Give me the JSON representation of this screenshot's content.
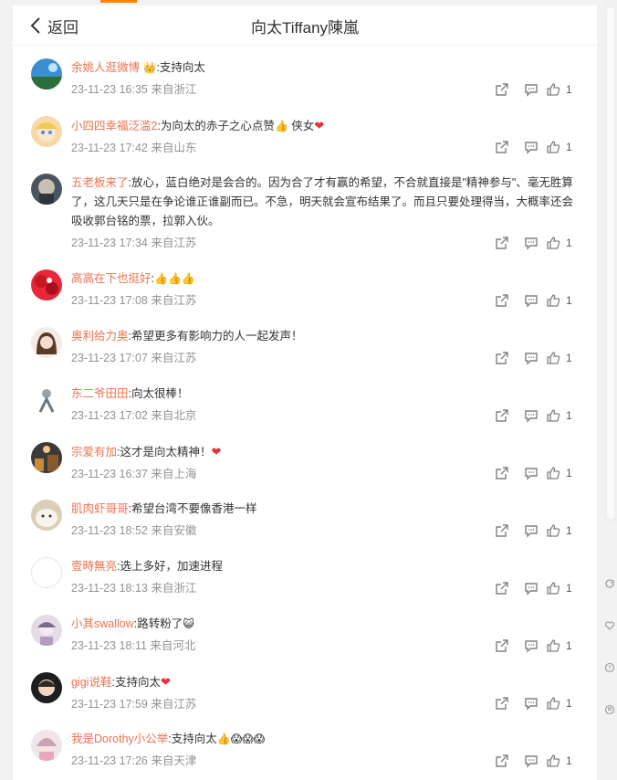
{
  "header": {
    "back_label": "返回",
    "title": "向太Tiffany陳嵐"
  },
  "comments": [
    {
      "user": "余姚人逛微博",
      "badge": "👑",
      "text": ":支持向太",
      "time": "23-11-23 16:35",
      "loc": "来自浙江",
      "likes": "1"
    },
    {
      "user": "小四四幸福泛滥2",
      "text": ":为向太的赤子之心点赞",
      "emoji": "👍",
      "text2": " 侠女",
      "heart": "❤",
      "time": "23-11-23 17:42",
      "loc": "来自山东",
      "likes": "1"
    },
    {
      "user": "五老板来了",
      "text": ":放心，蓝白绝对是会合的。因为合了才有赢的希望，不合就直接是\"精神参与\"、毫无胜算了，这几天只是在争论谁正谁副而已。不急，明天就会宣布结果了。而且只要处理得当，大概率还会吸收郭台铭的票，拉郭入伙。",
      "time": "23-11-23 17:34",
      "loc": "来自江苏",
      "likes": "1"
    },
    {
      "user": "高高在下也挺好",
      "text": ":",
      "emoji": "👍👍👍",
      "time": "23-11-23 17:08",
      "loc": "来自江苏",
      "likes": "1"
    },
    {
      "user": "奥利给力奥",
      "text": ":希望更多有影响力的人一起发声！",
      "time": "23-11-23 17:07",
      "loc": "来自江苏",
      "likes": "1"
    },
    {
      "user": "东二爷田田",
      "text": ":向太很棒！",
      "time": "23-11-23 17:02",
      "loc": "来自北京",
      "likes": "1"
    },
    {
      "user": "宗爱有加",
      "text": ":这才是向太精神！",
      "heart": "❤",
      "time": "23-11-23 16:37",
      "loc": "来自上海",
      "likes": "1"
    },
    {
      "user": "肌肉虾哥哥",
      "text": ":希望台湾不要像香港一样",
      "time": "23-11-23 18:52",
      "loc": "来自安徽",
      "likes": "1"
    },
    {
      "user": "壹時無亮",
      "text": ":选上多好，加速进程",
      "time": "23-11-23 18:13",
      "loc": "来自浙江",
      "likes": "1"
    },
    {
      "user": "小其swallow",
      "text": ":路转粉了",
      "emoji": "😺",
      "time": "23-11-23 18:11",
      "loc": "来自河北",
      "likes": "1"
    },
    {
      "user": "gigi说鞋",
      "text": ":支持向太",
      "heart": "❤",
      "time": "23-11-23 17:59",
      "loc": "来自江苏",
      "likes": "1"
    },
    {
      "user": "我是Dorothy小公举",
      "text": ":支持向太",
      "emoji": "👍😱😱😱",
      "time": "23-11-23 17:26",
      "loc": "来自天津",
      "likes": "1"
    }
  ],
  "icons": {
    "share": "share-icon",
    "comment": "comment-icon",
    "like": "thumbs-up-icon"
  },
  "colors": {
    "username": "#eb7350",
    "meta": "#939393",
    "accent": "#ff8200"
  }
}
